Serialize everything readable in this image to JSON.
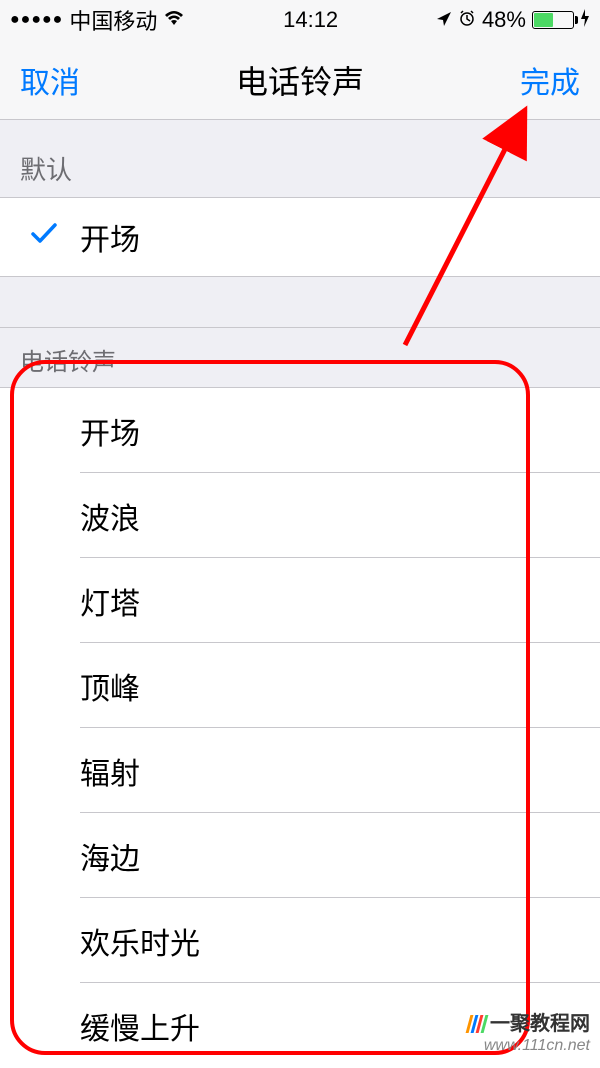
{
  "status": {
    "signal_dots": "●●●●●",
    "carrier": "中国移动",
    "time": "14:12",
    "battery_percent": "48%"
  },
  "nav": {
    "cancel": "取消",
    "title": "电话铃声",
    "done": "完成"
  },
  "default_section": {
    "header": "默认",
    "selected": "开场"
  },
  "ringtones_section": {
    "header": "电话铃声",
    "items": [
      "开场",
      "波浪",
      "灯塔",
      "顶峰",
      "辐射",
      "海边",
      "欢乐时光",
      "缓慢上升"
    ]
  },
  "watermark": {
    "brand": "一聚教程网",
    "url": "www.111cn.net"
  }
}
